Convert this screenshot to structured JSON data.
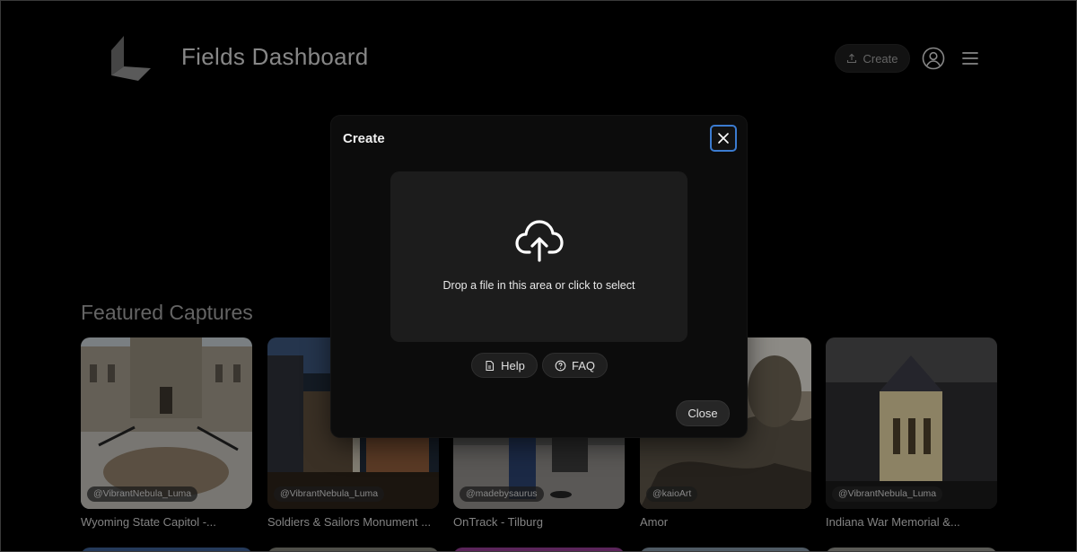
{
  "header": {
    "app_title": "Fields Dashboard",
    "create_label": "Create",
    "logo_icon": "luma-logo",
    "user_icon": "user-circle-icon",
    "menu_icon": "hamburger-menu-icon"
  },
  "featured": {
    "title": "Featured Captures",
    "cards": [
      {
        "author": "@VibrantNebula_Luma",
        "title": "Wyoming State Capitol -..."
      },
      {
        "author": "@VibrantNebula_Luma",
        "title": "Soldiers & Sailors Monument ..."
      },
      {
        "author": "@madebysaurus",
        "title": "OnTrack - Tilburg"
      },
      {
        "author": "@kaioArt",
        "title": "Amor"
      },
      {
        "author": "@VibrantNebula_Luma",
        "title": "Indiana War Memorial &..."
      }
    ]
  },
  "modal": {
    "title": "Create",
    "dropzone_text": "Drop a file in this area or click to select",
    "help_label": "Help",
    "faq_label": "FAQ",
    "close_label": "Close",
    "accent_color": "#3b7bd0"
  }
}
